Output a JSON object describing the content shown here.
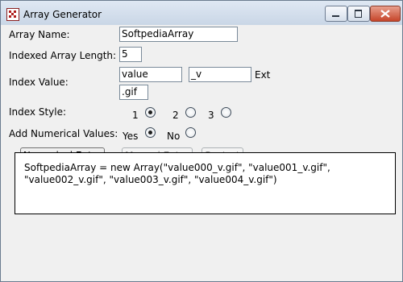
{
  "window": {
    "title": "Array Generator"
  },
  "form": {
    "array_name_label": "Array Name:",
    "array_name_value": "SoftpediaArray",
    "length_label": "Indexed Array Length:",
    "length_value": "5",
    "index_value_label": "Index Value:",
    "index_value_value": "value",
    "suffix_value": "_v",
    "ext_label": "Ext",
    "ext_value": ".gif",
    "index_style_label": "Index Style:",
    "index_style_options": [
      "1",
      "2",
      "3"
    ],
    "index_style_selected": "1",
    "numerical_label": "Add Numerical Values:",
    "yes_label": "Yes",
    "no_label": "No",
    "numerical_selected": "Yes"
  },
  "buttons": {
    "numerical_enter": "Numerical Enter",
    "manual_enter": "Manual Enter",
    "restart": "Restart"
  },
  "output": {
    "text": "SoftpediaArray = new Array(\"value000_v.gif\", \"value001_v.gif\", \"value002_v.gif\", \"value003_v.gif\", \"value004_v.gif\")"
  },
  "icons": {
    "app_icon": "app-icon",
    "minimize": "minimize-icon",
    "maximize": "maximize-icon",
    "close": "close-icon"
  }
}
